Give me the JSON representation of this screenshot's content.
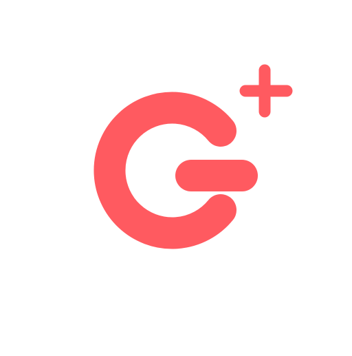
{
  "logo": {
    "icon": "g-plus-logo-icon",
    "color": "#FF5A60",
    "background": "#FFFFFF"
  }
}
